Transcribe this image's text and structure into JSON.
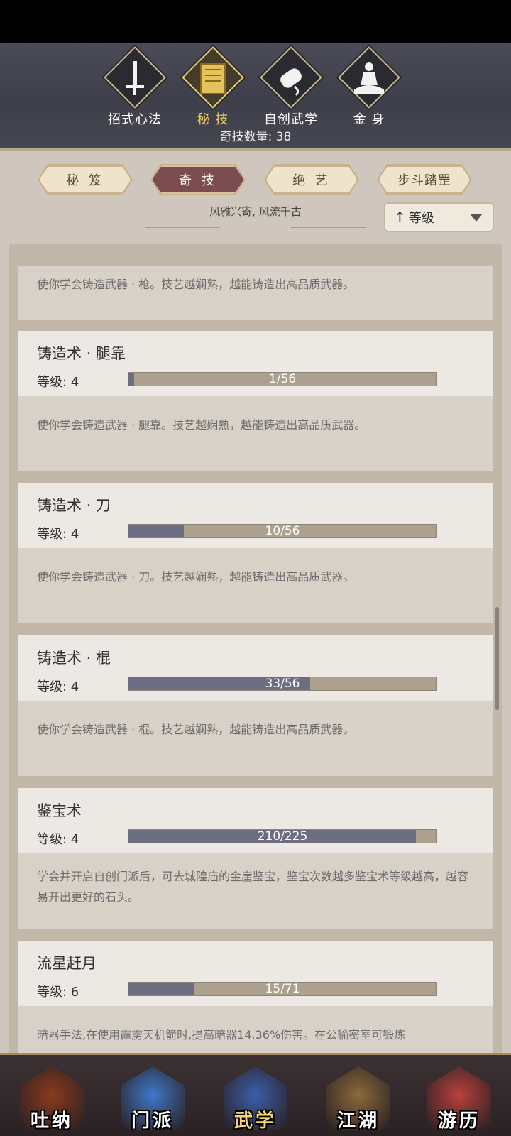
{
  "categories": [
    {
      "label": "招式心法",
      "icon": "sword-icon",
      "active": false
    },
    {
      "label": "秘 技",
      "icon": "book-icon",
      "active": true
    },
    {
      "label": "自创武学",
      "icon": "scroll-icon",
      "active": false
    },
    {
      "label": "金 身",
      "icon": "meditation-icon",
      "active": false
    }
  ],
  "count_text": "奇技数量: 38",
  "tabs": [
    {
      "label": "秘 笈",
      "active": false
    },
    {
      "label": "奇 技",
      "active": true
    },
    {
      "label": "绝 艺",
      "active": false
    },
    {
      "label": "步斗踏罡",
      "active": false
    }
  ],
  "motto": "风雅兴寄, 风流千古",
  "sort": {
    "arrow": "↑",
    "label": "等级"
  },
  "skills": [
    {
      "name": "",
      "level_text": "",
      "progress": null,
      "desc": "使你学会铸造武器 · 枪。技艺越娴熟，越能铸造出高品质武器。"
    },
    {
      "name": "铸造术 · 腿靠",
      "level_text": "等级: 4",
      "progress": {
        "text": "1/56",
        "fraction": 0.018
      },
      "desc": "使你学会铸造武器 · 腿靠。技艺越娴熟，越能铸造出高品质武器。"
    },
    {
      "name": "铸造术 · 刀",
      "level_text": "等级: 4",
      "progress": {
        "text": "10/56",
        "fraction": 0.179
      },
      "desc": "使你学会铸造武器 · 刀。技艺越娴熟，越能铸造出高品质武器。"
    },
    {
      "name": "铸造术 · 棍",
      "level_text": "等级: 4",
      "progress": {
        "text": "33/56",
        "fraction": 0.589
      },
      "desc": "使你学会铸造武器 · 棍。技艺越娴熟，越能铸造出高品质武器。"
    },
    {
      "name": "鉴宝术",
      "level_text": "等级: 4",
      "progress": {
        "text": "210/225",
        "fraction": 0.933
      },
      "desc": "学会并开启自创门派后，可去城隍庙的金崖鉴宝，鉴宝次数越多鉴宝术等级越高，越容易开出更好的石头。"
    },
    {
      "name": "流星赶月",
      "level_text": "等级: 6",
      "progress": {
        "text": "15/71",
        "fraction": 0.211
      },
      "desc": "暗器手法,在使用霹雳天机箭时,提高暗器14.36%伤害。在公输密室可锻炼"
    }
  ],
  "nav": [
    {
      "label": "吐纳",
      "icon": "monk-icon",
      "active": false,
      "color": "#8a3a1c"
    },
    {
      "label": "门派",
      "icon": "banner-icon",
      "active": false,
      "color": "#3e78c8"
    },
    {
      "label": "武学",
      "icon": "books-icon",
      "active": true,
      "color": "#3b5fa8"
    },
    {
      "label": "江湖",
      "icon": "straw-hat-icon",
      "active": false,
      "color": "#8c6a3a"
    },
    {
      "label": "游历",
      "icon": "horse-icon",
      "active": false,
      "color": "#b8413a"
    }
  ]
}
